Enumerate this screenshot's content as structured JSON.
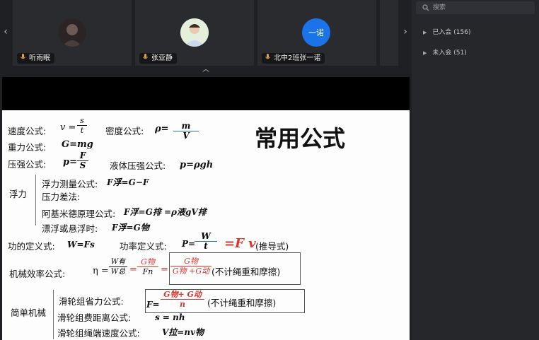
{
  "participants": [
    {
      "name": "听雨眠"
    },
    {
      "name": "张亚静"
    },
    {
      "name": "北中2班张一诺",
      "avatar_text": "一诺",
      "avatar_color": "#1a73e8"
    }
  ],
  "panel": {
    "search_placeholder": "搜索",
    "groups": [
      {
        "label": "已入会 (156)"
      },
      {
        "label": "未入会 (51)"
      }
    ]
  },
  "slide": {
    "title": "常用公式",
    "title_color": "#d9362b",
    "speed_label": "速度公式:",
    "speed_eq": "v =",
    "speed_num": "s",
    "speed_den": "t",
    "density_label": "密度公式:",
    "density_eq": "ρ=",
    "density_num": "m",
    "density_den": "V",
    "gravity_label": "重力公式:",
    "gravity_eq": "G=mg",
    "pressure_label": "压强公式:",
    "pressure_eq": "p=",
    "pressure_num": "F",
    "pressure_den": "S",
    "liquid_label": "液体压强公式:",
    "liquid_eq": "p=ρgh",
    "buoyancy_label": "浮力",
    "buoy1": "浮力测量公式:",
    "buoy1_eq": "F浮=G−F",
    "buoy2": "压力差法:",
    "buoy3": "阿基米德原理公式:",
    "buoy3_eq": "F浮=G排 =ρ液gV排",
    "buoy4": "漂浮或悬浮时:",
    "buoy4_eq": "F浮=G物",
    "work_label": "功的定义式:",
    "work_eq": "W=Fs",
    "power_label": "功率定义式:",
    "power_eq": "P=",
    "power_num": "W",
    "power_den": "t",
    "power_eq2": "=F v",
    "power_note": "(推导式)",
    "eff_label": "机械效率公式:",
    "eff_eq": "η =",
    "eff_num1": "W有",
    "eff_den1": "W总",
    "eff_num2": "G物",
    "eff_den2": "Fn",
    "eff_num3": "G物",
    "eff_den3": "G物 +G动",
    "eff_note": "(不计绳重和摩擦)",
    "simple_label": "简单机械",
    "pulley1": "滑轮组省力公式:",
    "pulley1_eq": "F=",
    "pulley1_num": "G物+ G动",
    "pulley1_den": "n",
    "pulley1_note": "(不计绳重和摩擦)",
    "pulley2": "滑轮组费距离公式:",
    "pulley2_eq": "s = nh",
    "pulley3": "滑轮组绳端速度公式:",
    "pulley3_eq": "V拉=nv物"
  }
}
